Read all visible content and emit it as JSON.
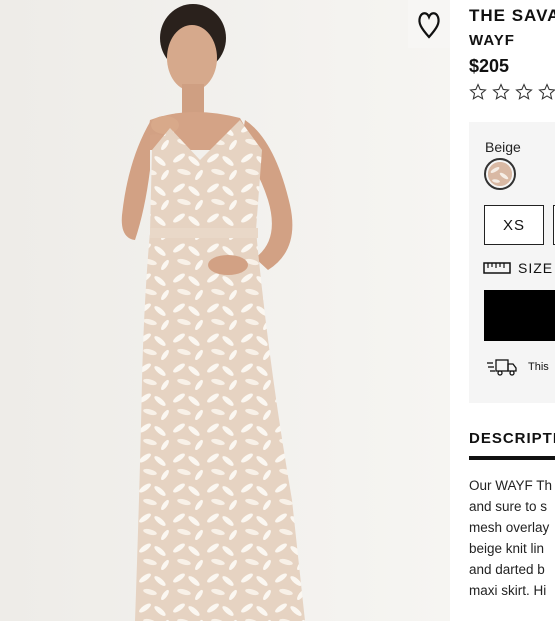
{
  "product": {
    "title": "THE SAVA",
    "brand": "WAYF",
    "price": "$205",
    "rating_stars": 5,
    "rating_filled": 0
  },
  "options": {
    "color_label": "Beige",
    "selected_size": "XS",
    "size_chart_label": "SIZE C",
    "shipping_text": "This"
  },
  "description": {
    "heading": "DESCRIPTI",
    "lines": [
      "Our WAYF Th",
      "and sure to s",
      "mesh overlay",
      "beige knit lin",
      "and darted b",
      "maxi skirt. Hi"
    ]
  },
  "icons": {
    "wishlist": "heart-outline-icon",
    "star": "star-outline-icon",
    "size_chart": "ruler-icon",
    "shipping": "delivery-truck-icon"
  },
  "colors": {
    "swatch": "#d9b9a4",
    "button": "#000000",
    "panel": "#f5f5f5"
  }
}
